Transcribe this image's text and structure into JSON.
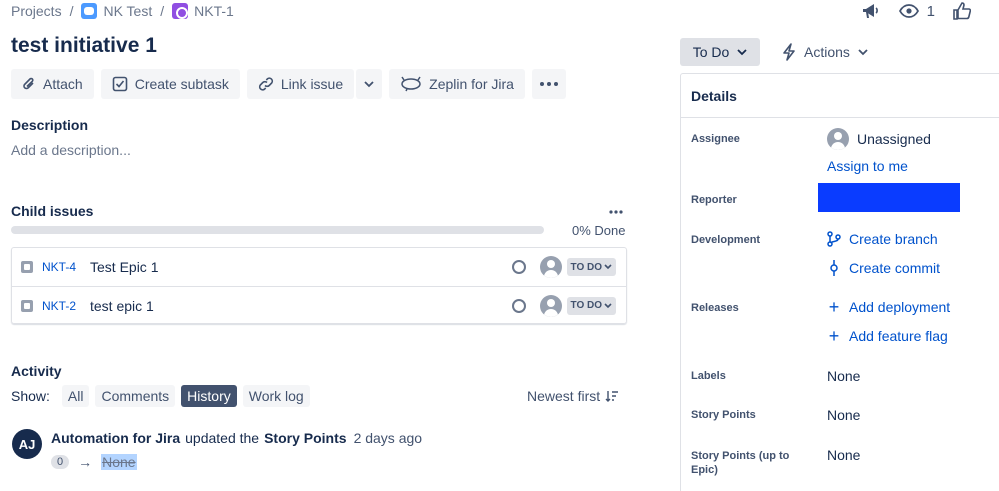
{
  "breadcrumb": {
    "projects": "Projects",
    "project": "NK Test",
    "issue": "NKT-1"
  },
  "topbar": {
    "watch_count": "1"
  },
  "issue": {
    "title": "test initiative 1"
  },
  "toolbar": {
    "attach": "Attach",
    "create_subtask": "Create subtask",
    "link_issue": "Link issue",
    "zeplin": "Zeplin for Jira"
  },
  "description": {
    "heading": "Description",
    "placeholder": "Add a description..."
  },
  "child_issues": {
    "heading": "Child issues",
    "progress_percent": 0,
    "progress_text": "0% Done",
    "rows": [
      {
        "key": "NKT-4",
        "summary": "Test Epic 1",
        "status": "TO DO"
      },
      {
        "key": "NKT-2",
        "summary": "test epic 1",
        "status": "TO DO"
      }
    ]
  },
  "activity": {
    "heading": "Activity",
    "show_label": "Show:",
    "filters": [
      "All",
      "Comments",
      "History",
      "Work log"
    ],
    "active_filter": "History",
    "sort": "Newest first",
    "entry": {
      "avatar_initials": "AJ",
      "actor": "Automation for Jira",
      "verb": "updated the",
      "field": "Story Points",
      "time": "2 days ago",
      "old_value": "0",
      "new_value": "None"
    }
  },
  "sidebar": {
    "status": "To Do",
    "actions": "Actions",
    "details_heading": "Details",
    "fields": {
      "assignee_label": "Assignee",
      "assignee_value": "Unassigned",
      "assign_to_me": "Assign to me",
      "reporter_label": "Reporter",
      "development_label": "Development",
      "create_branch": "Create branch",
      "create_commit": "Create commit",
      "releases_label": "Releases",
      "add_deployment": "Add deployment",
      "add_feature_flag": "Add feature flag",
      "labels_label": "Labels",
      "labels_value": "None",
      "story_points_label": "Story Points",
      "story_points_value": "None",
      "story_points_epic_label": "Story Points (up to Epic)",
      "story_points_epic_value": "None"
    }
  },
  "colors": {
    "link": "#0052cc",
    "text": "#172b4d",
    "subtle": "#42526e",
    "redaction": "#0a3cff"
  },
  "icons": [
    "project-icon",
    "epic-icon",
    "megaphone-icon",
    "eye-icon",
    "thumbs-up-icon",
    "paperclip-icon",
    "subtask-icon",
    "link-icon",
    "chevron-down-icon",
    "zeplin-icon",
    "more-icon",
    "lightning-icon",
    "branch-icon",
    "commit-icon",
    "plus-icon",
    "sort-icon"
  ]
}
